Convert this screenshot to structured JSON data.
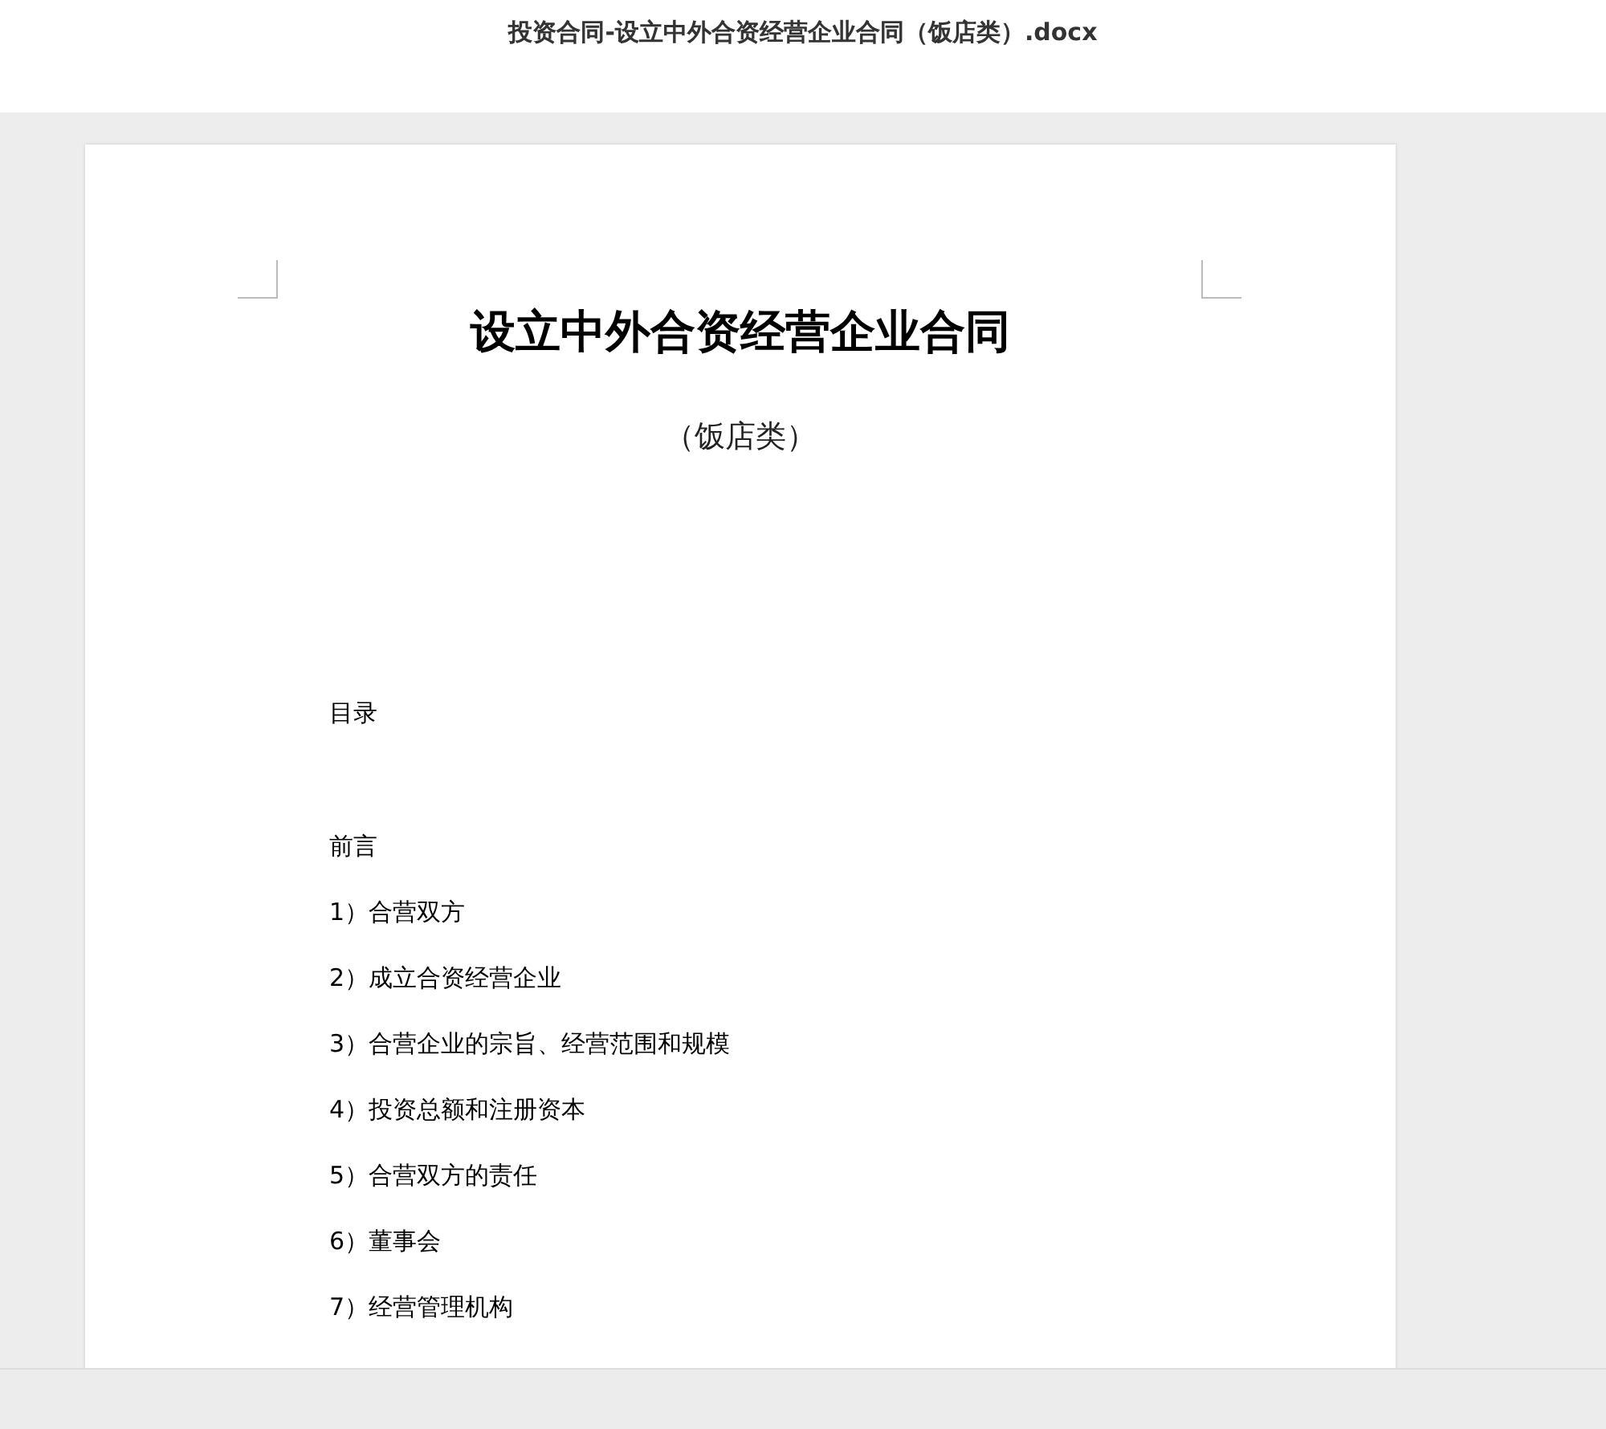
{
  "window": {
    "title": "投资合同-设立中外合资经营企业合同（饭店类）.docx"
  },
  "document": {
    "title": "设立中外合资经营企业合同",
    "subtitle": "（饭店类）",
    "toc_heading": "目录",
    "preface": "前言",
    "toc_items": [
      "1）合营双方",
      "2）成立合资经营企业",
      "3）合营企业的宗旨、经营范围和规模",
      "4）投资总额和注册资本",
      "5）合营双方的责任",
      "6）董事会",
      "7）经营管理机构"
    ]
  }
}
